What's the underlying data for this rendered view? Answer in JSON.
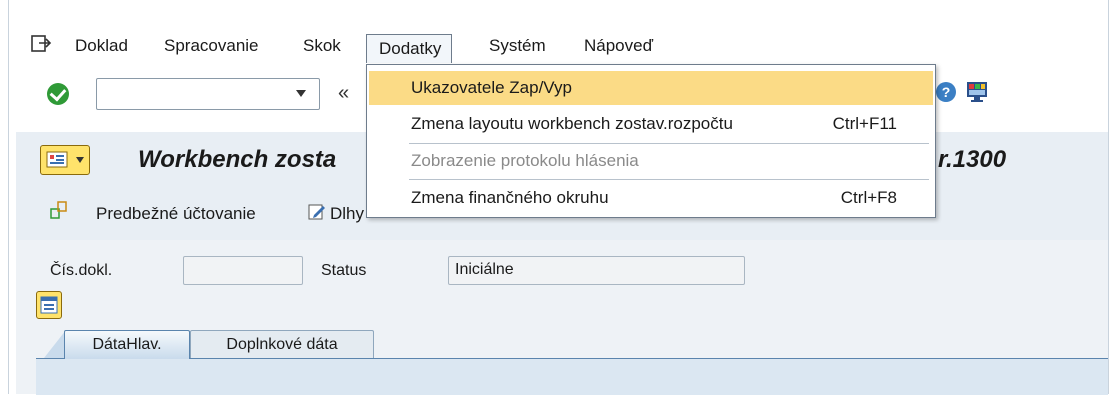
{
  "menubar": {
    "items": [
      {
        "label": "Doklad"
      },
      {
        "label": "Spracovanie"
      },
      {
        "label": "Skok"
      },
      {
        "label": "Dodatky"
      },
      {
        "label": "Systém"
      },
      {
        "label": "Nápoveď"
      }
    ]
  },
  "toolbar": {
    "command_value": "",
    "collapse_glyph": "«"
  },
  "title": {
    "text_left": "Workbench zosta",
    "text_right": "r.1300"
  },
  "app_toolbar": {
    "btn1_label": "Predbežné účtovanie",
    "btn2_label": "Dlhy"
  },
  "form": {
    "doc_label": "Čís.dokl.",
    "doc_value": "",
    "status_label": "Status",
    "status_value": "Iniciálne"
  },
  "tabs": [
    {
      "label": "DátaHlav."
    },
    {
      "label": "Doplnkové dáta"
    }
  ],
  "dropdown": {
    "items": [
      {
        "label": "Ukazovatele Zap/Vyp",
        "shortcut": "",
        "state": "highlighted"
      },
      {
        "label": "Zmena layoutu workbench zostav.rozpočtu",
        "shortcut": "Ctrl+F11",
        "state": "enabled"
      },
      {
        "label": "Zobrazenie protokolu hlásenia",
        "shortcut": "",
        "state": "disabled"
      },
      {
        "label": "Zmena finančného okruhu",
        "shortcut": "Ctrl+F8",
        "state": "enabled"
      }
    ]
  },
  "colors": {
    "highlight": "#fbdb86",
    "panel": "#e8eef4",
    "accent_yellow": "#ffe36b",
    "ok_green": "#2f9a37"
  },
  "icons": [
    "exit-icon",
    "ok-icon",
    "help-icon",
    "layout-icon",
    "post-icon",
    "edit-icon",
    "nav-icon"
  ]
}
